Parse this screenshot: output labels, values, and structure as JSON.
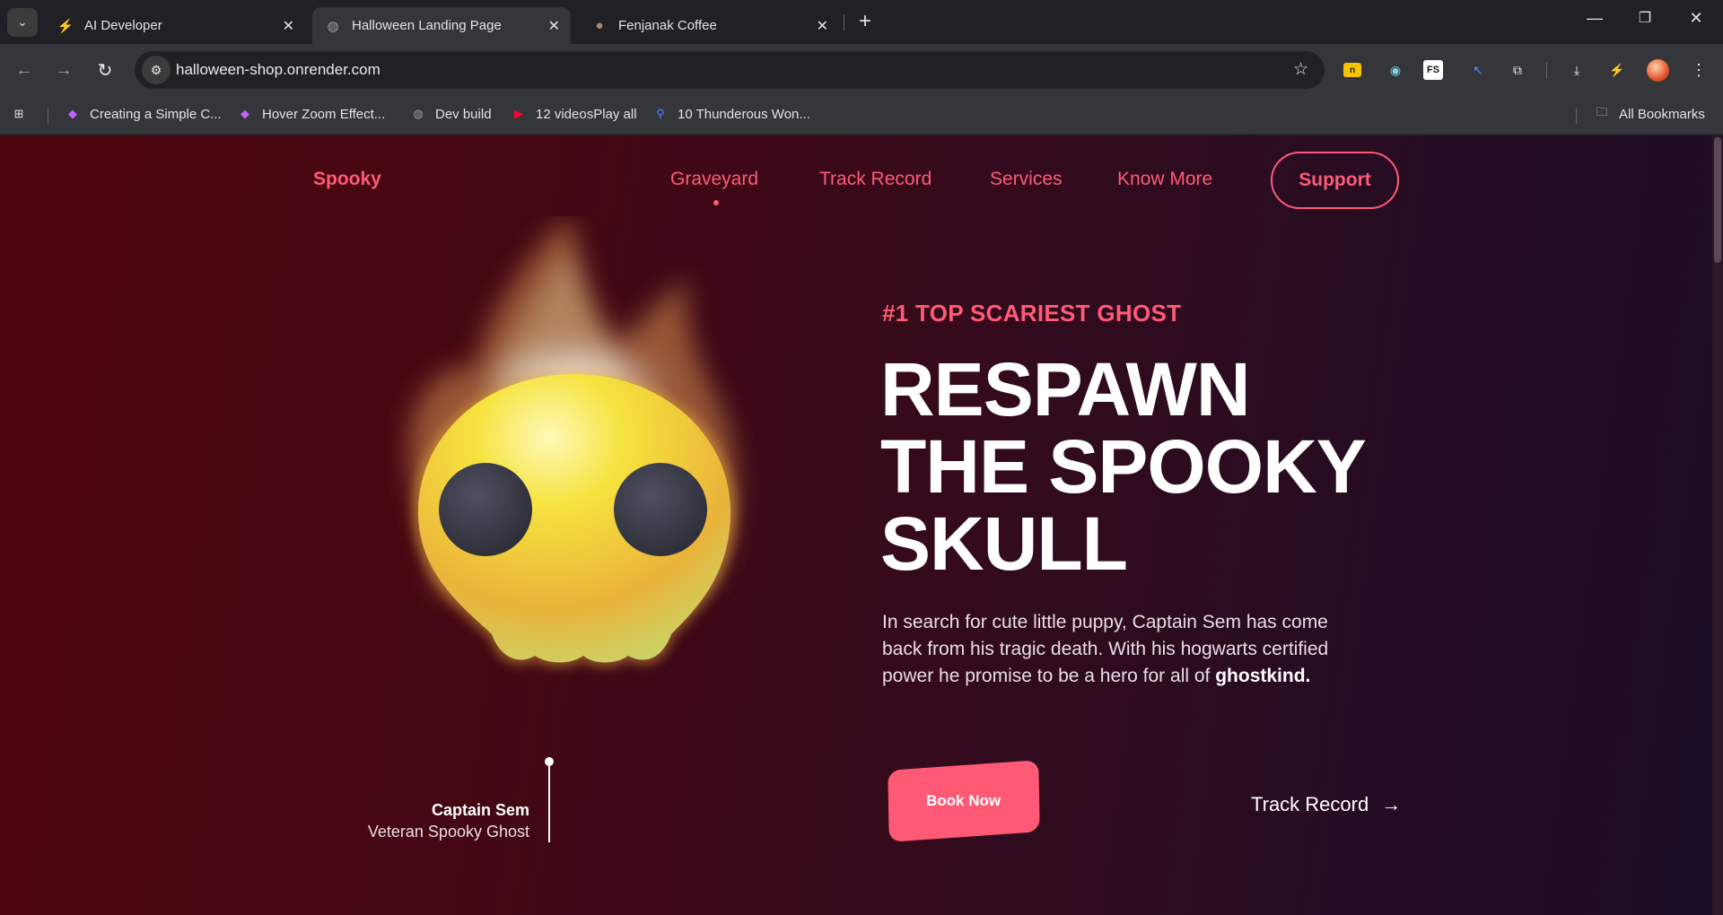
{
  "browser": {
    "tabs": [
      {
        "title": "AI Developer",
        "icon": "lightning-icon"
      },
      {
        "title": "Halloween Landing Page",
        "icon": "globe-icon",
        "active": true
      },
      {
        "title": "Fenjanak Coffee",
        "icon": "coffee-icon"
      }
    ],
    "url": "halloween-shop.onrender.com",
    "bookmarks": [
      {
        "label": "Creating a Simple C...",
        "icon": "diamond-icon"
      },
      {
        "label": "Hover Zoom Effect...",
        "icon": "diamond-icon"
      },
      {
        "label": "Dev build",
        "icon": "globe-icon"
      },
      {
        "label": "12 videosPlay all",
        "icon": "youtube-icon"
      },
      {
        "label": "10 Thunderous Won...",
        "icon": "search-icon"
      }
    ],
    "all_bookmarks": "All Bookmarks"
  },
  "site": {
    "logo": "Spooky",
    "nav": [
      "Graveyard",
      "Track Record",
      "Services",
      "Know More"
    ],
    "support": "Support",
    "eyebrow": "#1 TOP SCARIEST GHOST",
    "headline": [
      "RESPAWN",
      "THE SPOOKY",
      "SKULL"
    ],
    "description": "In search for cute little puppy, Captain Sem has come back from his tragic death. With his hogwarts certified power he promise to be a hero for all of",
    "description_bold": "ghostkind.",
    "book_now": "Book Now",
    "track_record": "Track Record",
    "character": {
      "name": "Captain Sem",
      "role": "Veteran Spooky Ghost"
    }
  },
  "colors": {
    "accent": "#ff5b76",
    "bg_left": "#4e0710",
    "bg_right": "#1a0d26"
  }
}
